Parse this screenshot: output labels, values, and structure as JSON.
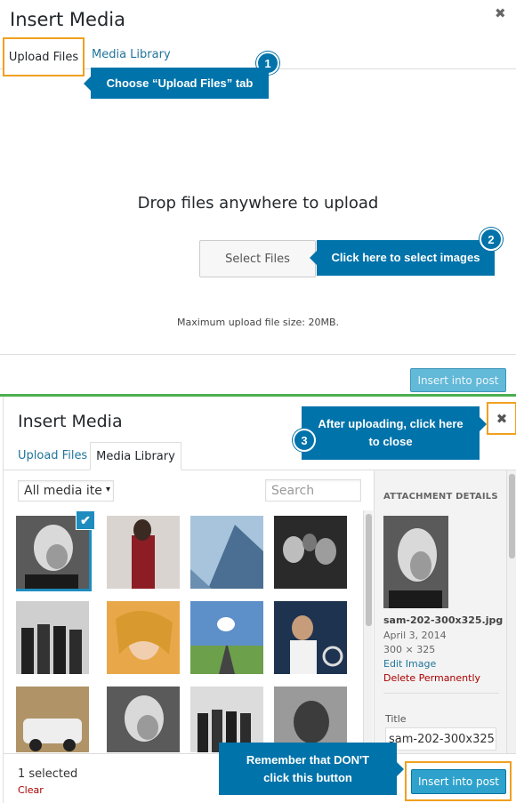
{
  "panel_top": {
    "title": "Insert Media",
    "close_glyph": "✖",
    "tabs": [
      {
        "label": "Upload Files",
        "active": true
      },
      {
        "label": "Media Library",
        "active": false
      }
    ],
    "callout_1": {
      "number": "1",
      "text": "Choose “Upload Files” tab"
    },
    "drop_text": "Drop files anywhere to upload",
    "select_button": "Select Files",
    "callout_2": {
      "number": "2",
      "text": "Click here to select images"
    },
    "max_upload": "Maximum upload file size: 20MB.",
    "insert_button": "Insert into post"
  },
  "panel_bottom": {
    "title": "Insert Media",
    "close_glyph": "✖",
    "callout_3": {
      "number": "3",
      "text": "After uploading, click here to close"
    },
    "tabs": [
      {
        "label": "Upload Files",
        "active": false
      },
      {
        "label": "Media Library",
        "active": true
      }
    ],
    "filter": {
      "value": "All media ite",
      "caret": "▾"
    },
    "search": {
      "placeholder": "Search"
    },
    "check_glyph": "✔",
    "attachment": {
      "header": "ATTACHMENT DETAILS",
      "filename": "sam-202-300x325.jpg",
      "date": "April 3, 2014",
      "dimensions": "300 × 325",
      "edit_link": "Edit Image",
      "delete_link": "Delete Permanently",
      "title_label": "Title",
      "title_value": "sam-202-300x325"
    },
    "selected_count": "1 selected",
    "clear_link": "Clear",
    "callout_4": {
      "text": "Remember that DON'T click this button"
    },
    "insert_button": "Insert into post"
  },
  "colors": {
    "callout": "#0073aa",
    "highlight": "#f0a020",
    "divider": "#4caf50",
    "link": "#21759b",
    "danger": "#aa0000"
  }
}
